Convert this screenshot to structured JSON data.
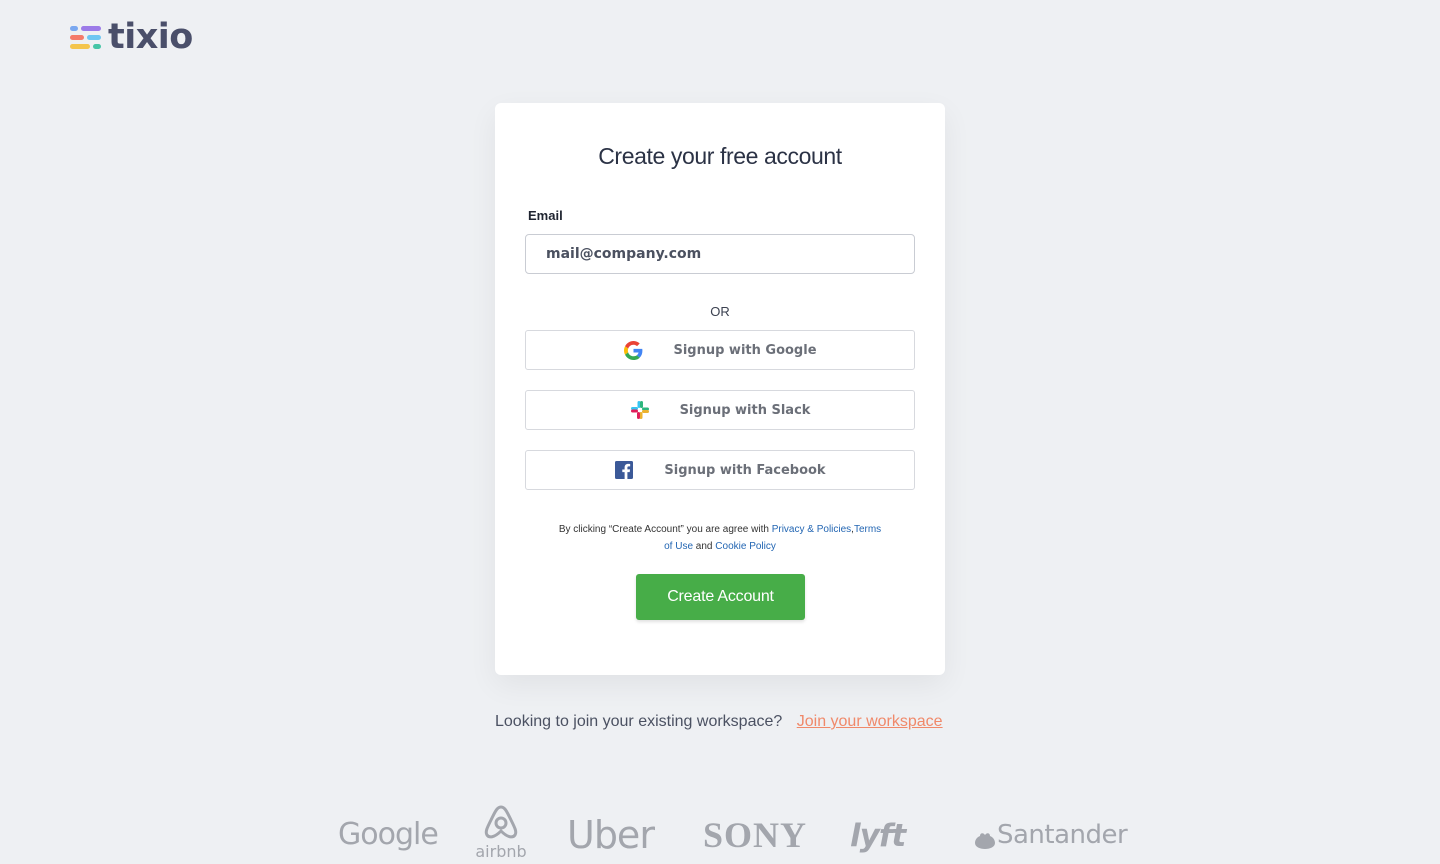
{
  "logo": {
    "text": "tixio",
    "bar_colors": [
      "#7aa8f0",
      "#f47b6b",
      "#46c5a6",
      "#f4c54d",
      "#6ec6f2",
      "#9c7be8"
    ]
  },
  "card": {
    "title": "Create your free account",
    "email": {
      "label": "Email",
      "placeholder": "mail@company.com",
      "value": ""
    },
    "or_label": "OR",
    "google_label": "Signup with Google",
    "slack_label": "Signup with Slack",
    "facebook_label": "Signup with Facebook",
    "terms": {
      "prefix": "By clicking “Create Account” you are agree with ",
      "privacy": "Privacy & Policies",
      "comma": ",",
      "terms_of_use": "Terms of Use",
      "and": " and ",
      "cookie": "Cookie Policy"
    },
    "create_label": "Create Account"
  },
  "join": {
    "text": "Looking to join your existing workspace?",
    "link": "Join your workspace"
  },
  "brands": [
    "Google",
    "airbnb",
    "Uber",
    "SONY",
    "lyft",
    "Santander"
  ],
  "colors": {
    "accent_green": "#47ad48",
    "link_blue": "#2366b3",
    "join_link": "#f0896a",
    "facebook_blue": "#3b5998"
  }
}
